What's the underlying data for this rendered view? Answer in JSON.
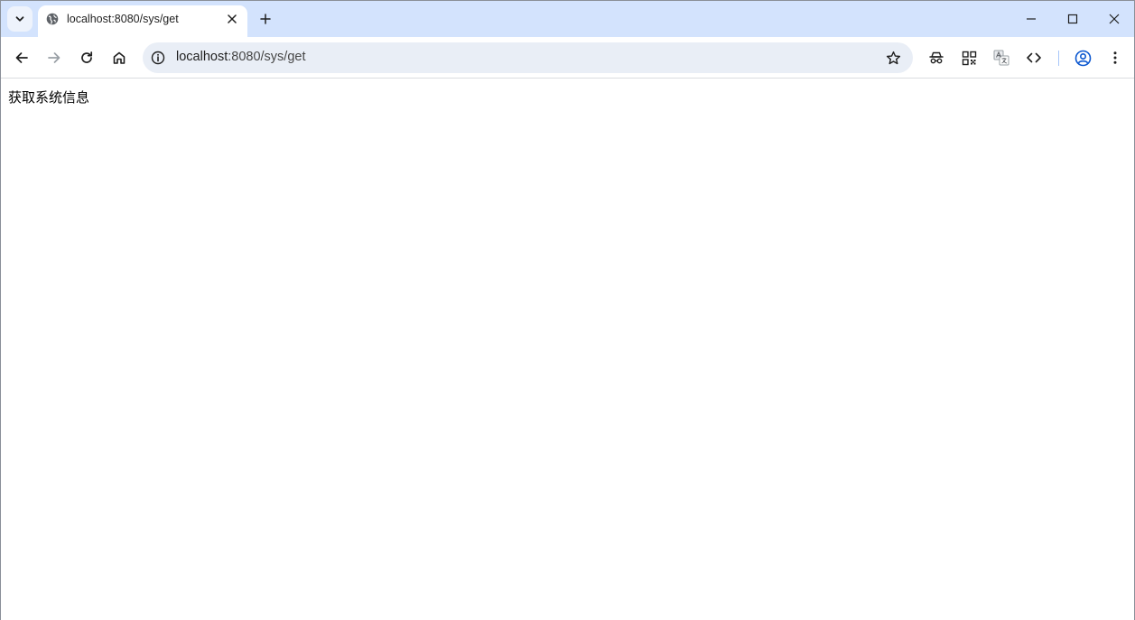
{
  "tab": {
    "title": "localhost:8080/sys/get"
  },
  "omnibox": {
    "host": "localhost",
    "path": ":8080/sys/get"
  },
  "page": {
    "body_text": "获取系统信息"
  },
  "colors": {
    "tabstrip": "#d3e3fd",
    "omnibox": "#e9eef6",
    "profile_accent": "#0b57d0"
  }
}
